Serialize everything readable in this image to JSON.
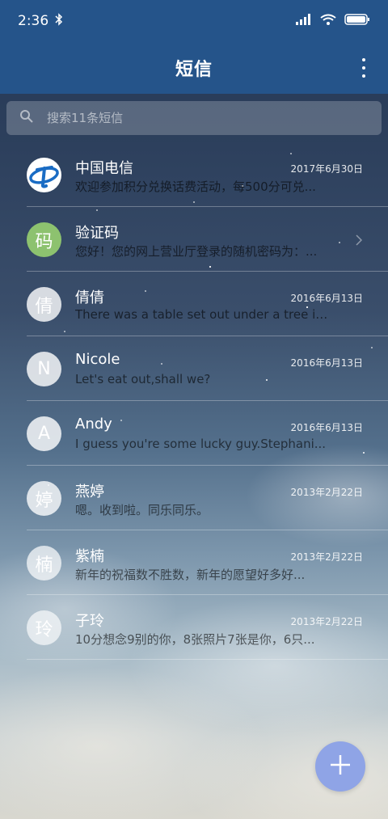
{
  "status_bar": {
    "time": "2:36"
  },
  "app_bar": {
    "title": "短信"
  },
  "search": {
    "placeholder": "搜索11条短信"
  },
  "accent": "#25548a",
  "fab_color": "#8fa4e6",
  "conversations": [
    {
      "avatar": "",
      "avatar_icon": "china-telecom-logo",
      "name": "中国电信",
      "date": "2017年6月30日",
      "preview": "欢迎参加积分兑换话费活动，每500分可兑..."
    },
    {
      "avatar": "码",
      "avatar_color": "#8dc26f",
      "name": "验证码",
      "date": "",
      "preview": "您好！您的网上营业厅登录的随机密码为：..."
    },
    {
      "avatar": "倩",
      "name": "倩倩",
      "date": "2016年6月13日",
      "preview": "There was a table set out under a tree in..."
    },
    {
      "avatar": "N",
      "name": "Nicole",
      "date": "2016年6月13日",
      "preview": "Let's eat out,shall we?"
    },
    {
      "avatar": "A",
      "name": "Andy",
      "date": "2016年6月13日",
      "preview": "I guess you're some lucky guy.Stephani..."
    },
    {
      "avatar": "婷",
      "name": "燕婷",
      "date": "2013年2月22日",
      "preview": "嗯。收到啦。同乐同乐。"
    },
    {
      "avatar": "楠",
      "name": "紫楠",
      "date": "2013年2月22日",
      "preview": "新年的祝福数不胜数，新年的愿望好多好..."
    },
    {
      "avatar": "玲",
      "name": "子玲",
      "date": "2013年2月22日",
      "preview": "10分想念9别的你，8张照片7张是你，6只..."
    }
  ]
}
